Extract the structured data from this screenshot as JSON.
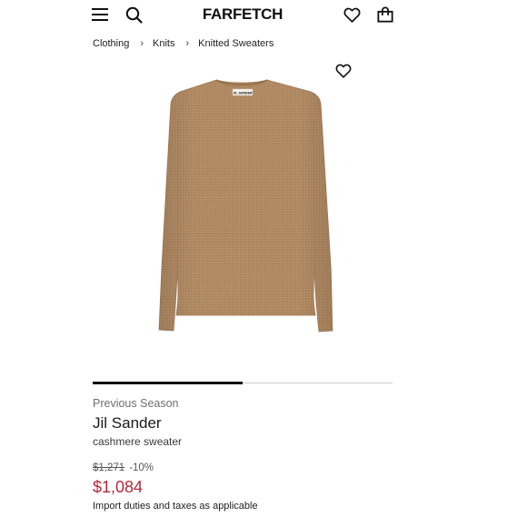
{
  "header": {
    "logo": "FARFETCH",
    "menu_icon": "hamburger-menu-icon",
    "search_icon": "search-icon",
    "wishlist_icon": "heart-icon",
    "bag_icon": "shopping-bag-icon"
  },
  "breadcrumb": {
    "items": [
      "Clothing",
      "Knits",
      "Knitted Sweaters"
    ],
    "separator": "›"
  },
  "product": {
    "image_label": "JIL SANDER",
    "gallery_progress": 0.5,
    "season": "Previous Season",
    "brand": "Jil Sander",
    "description": "cashmere sweater",
    "original_price": "$1,271",
    "discount": "-10%",
    "sale_price": "$1,084",
    "duties_note": "Import duties and taxes as applicable"
  },
  "colors": {
    "sale_price": "#b5283b",
    "sweater": "#b08a63",
    "progress": "#111111"
  }
}
